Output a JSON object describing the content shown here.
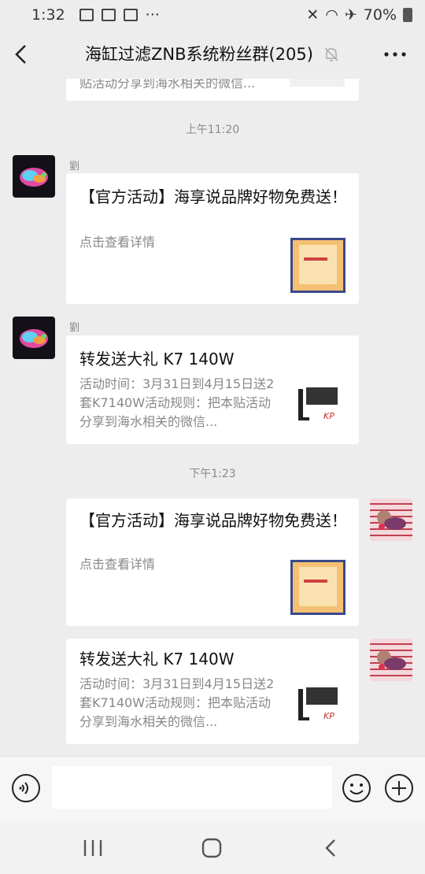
{
  "status": {
    "time": "1:32",
    "battery": "70%"
  },
  "header": {
    "title": "海缸过滤ZNB系统粉丝群(205)"
  },
  "messages": {
    "partial_card": {
      "desc": "贴活动分享到海水相关的微信..."
    },
    "ts1": "上午11:20",
    "m1": {
      "sender": "劉",
      "title": "【官方活动】海享说品牌好物免费送！",
      "desc": "点击查看详情"
    },
    "m2": {
      "sender": "劉",
      "title": "转发送大礼 K7 140W",
      "desc": "活动时间：3月31日到4月15日送2套K7140W活动规则：把本贴活动分享到海水相关的微信..."
    },
    "ts2": "下午1:23",
    "m3": {
      "title": "【官方活动】海享说品牌好物免费送！",
      "desc": "点击查看详情"
    },
    "m4": {
      "title": "转发送大礼 K7 140W",
      "desc": "活动时间：3月31日到4月15日送2套K7140W活动规则：把本贴活动分享到海水相关的微信..."
    }
  },
  "input": {
    "placeholder": ""
  },
  "colors": {
    "background": "#ededed",
    "card": "#ffffff",
    "timestamp": "#8a8a8a"
  }
}
